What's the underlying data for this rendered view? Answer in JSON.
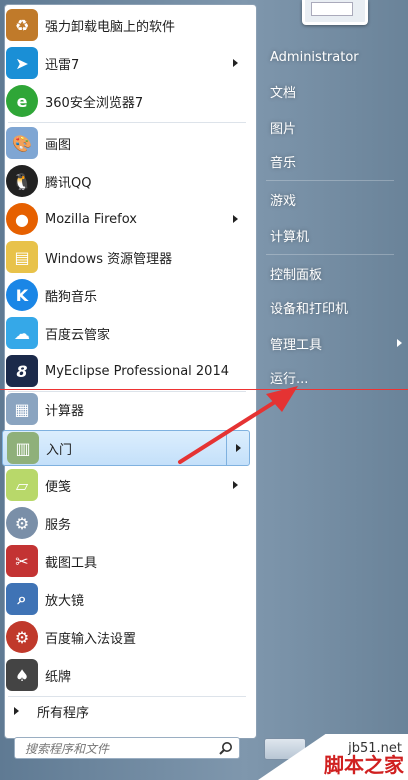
{
  "left_menu": {
    "pinned": [
      {
        "label": "强力卸载电脑上的软件",
        "icon": "trash-icon",
        "color": "#c07a2a",
        "arrow": false
      },
      {
        "label": "迅雷7",
        "icon": "thunder-bird-icon",
        "color": "#1a8fd6",
        "arrow": true
      },
      {
        "label": "360安全浏览器7",
        "icon": "360-browser-icon",
        "color": "#2fa637",
        "arrow": false
      }
    ],
    "recent": [
      {
        "label": "画图",
        "icon": "paint-palette-icon",
        "color": "#7fa6d3",
        "arrow": false
      },
      {
        "label": "腾讯QQ",
        "icon": "qq-penguin-icon",
        "color": "#222222",
        "arrow": false
      },
      {
        "label": "Mozilla Firefox",
        "icon": "firefox-icon",
        "color": "#e66000",
        "arrow": true
      },
      {
        "label": "Windows 资源管理器",
        "icon": "folder-icon",
        "color": "#e8c24a",
        "arrow": false
      },
      {
        "label": "酷狗音乐",
        "icon": "kugou-icon",
        "color": "#1a86e6",
        "arrow": false
      },
      {
        "label": "百度云管家",
        "icon": "baidu-cloud-icon",
        "color": "#35a8e8",
        "arrow": false
      },
      {
        "label": "MyEclipse Professional 2014",
        "icon": "myeclipse-icon",
        "color": "#1b2a4a",
        "arrow": false
      },
      {
        "label": "计算器",
        "icon": "calculator-icon",
        "color": "#8aa4c0",
        "arrow": false
      },
      {
        "label": "入门",
        "icon": "getting-started-icon",
        "color": "#8fb07a",
        "arrow": true,
        "highlighted": true
      },
      {
        "label": "便笺",
        "icon": "sticky-note-icon",
        "color": "#b8d86a",
        "arrow": true
      },
      {
        "label": "服务",
        "icon": "gear-icon",
        "color": "#7a8fa8",
        "arrow": false
      },
      {
        "label": "截图工具",
        "icon": "scissors-icon",
        "color": "#c33333",
        "arrow": false
      },
      {
        "label": "放大镜",
        "icon": "magnifier-icon",
        "color": "#3f73b5",
        "arrow": false
      },
      {
        "label": "百度输入法设置",
        "icon": "settings-icon",
        "color": "#c0392b",
        "arrow": false
      },
      {
        "label": "纸牌",
        "icon": "playing-cards-icon",
        "color": "#444444",
        "arrow": false
      }
    ],
    "all_programs": "所有程序",
    "search_placeholder": "搜索程序和文件"
  },
  "right_menu": {
    "items": [
      {
        "label": "Administrator",
        "arrow": false
      },
      {
        "label": "文档",
        "arrow": false
      },
      {
        "label": "图片",
        "arrow": false
      },
      {
        "label": "音乐",
        "arrow": false
      },
      {
        "label": "游戏",
        "arrow": false
      },
      {
        "label": "计算机",
        "arrow": false
      },
      {
        "label": "控制面板",
        "arrow": false
      },
      {
        "label": "设备和打印机",
        "arrow": false
      },
      {
        "label": "管理工具",
        "arrow": true
      },
      {
        "label": "运行...",
        "arrow": false
      }
    ]
  },
  "watermark": {
    "site": "jb51.net",
    "name": "脚本之家"
  },
  "colors": {
    "accent_red": "#e53333",
    "highlight_border": "#7fb1df"
  }
}
